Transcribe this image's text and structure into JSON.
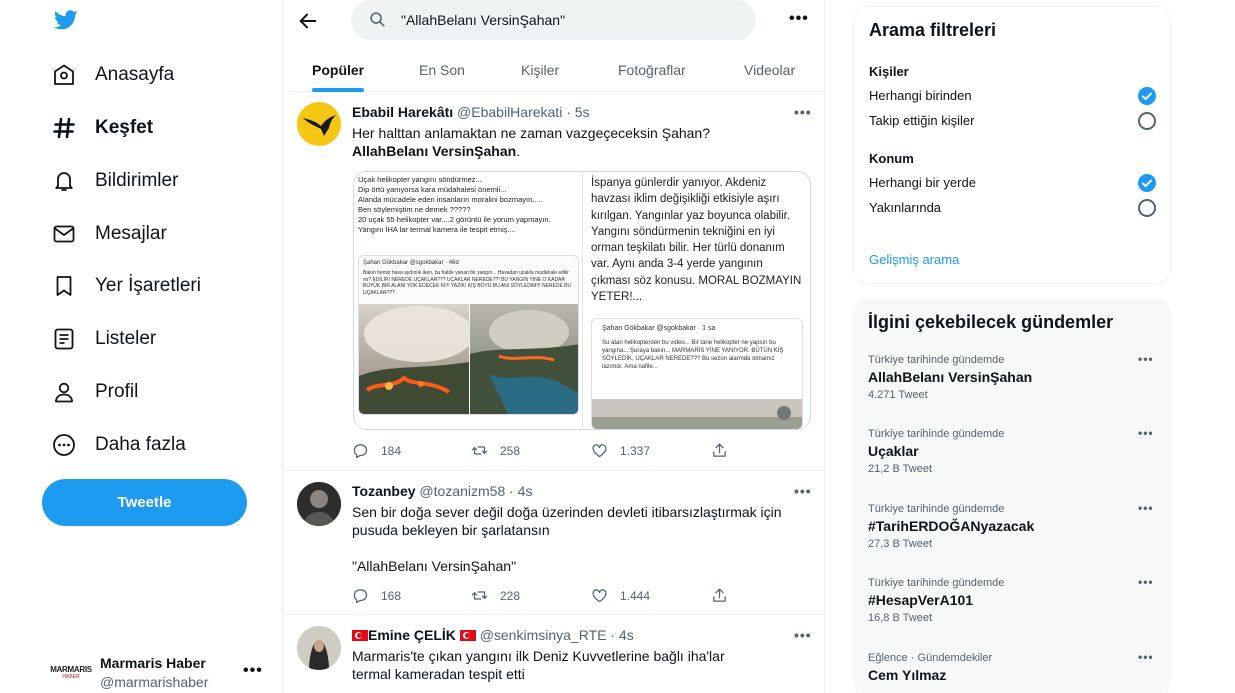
{
  "nav": {
    "items": [
      {
        "label": "Anasayfa",
        "icon": "home-icon"
      },
      {
        "label": "Keşfet",
        "icon": "hashtag-icon"
      },
      {
        "label": "Bildirimler",
        "icon": "bell-icon"
      },
      {
        "label": "Mesajlar",
        "icon": "envelope-icon"
      },
      {
        "label": "Yer İşaretleri",
        "icon": "bookmark-icon"
      },
      {
        "label": "Listeler",
        "icon": "list-icon"
      },
      {
        "label": "Profil",
        "icon": "person-icon"
      },
      {
        "label": "Daha fazla",
        "icon": "more-circle-icon"
      }
    ],
    "tweet_button": "Tweetle"
  },
  "account": {
    "logo_line1": "MARMARIS",
    "logo_line2": "HABER",
    "name": "Marmaris Haber",
    "handle": "@marmarishaber"
  },
  "search": {
    "query": "\"AllahBelanı VersinŞahan\"",
    "more": "•••"
  },
  "tabs": [
    "Popüler",
    "En Son",
    "Kişiler",
    "Fotoğraflar",
    "Videolar"
  ],
  "tweets": [
    {
      "name": "Ebabil Harekâtı",
      "handle": "@EbabilHarekati",
      "time": "· 5s",
      "text_plain": "Her halttan anlamaktan ne zaman vazgeçeceksin Şahan? ",
      "text_bold_1": "AllahBelanı",
      "text_bold_2": "VersinŞahan",
      "text_end": ".",
      "replies": "184",
      "retweets": "258",
      "likes": "1.337",
      "media": {
        "left_text": "Uçak helikopter yangını söndürmez...\nDip örtü yanıyorsa kara müdahalesi önemli...\nAlanda mücadele eden insanların moralini bozmayın.....\nBen söylemiştim ne demek ?????\n20 uçak 55 helikopter var....2 görüntü ile yorum yapmayın.\nYangını İHA lar termal kamera ile tespit etmiş....",
        "left_quote_head": "Şahan Gökbakar @sgokbakar · 46d",
        "left_quote_text": "Bakın hemiz hava aydınlık iken, bu halde yanan bir yangın... Havadan ucakla mudahale edilir mi? EDİLİR! NEREDE UÇAKLAR??? UÇAKLAR NEREDE??! BU YANGIN YINE O KADAR BÜYÜK BIR ALANI YOK EDECEK Kİ!!! YAZIK! KIŞ BOYU BU ANI SÖYLEDIM!!! NEREDE BU UÇAKLAR???",
        "right_text": "İspanya günlerdir yanıyor. Akdeniz havzası iklim değişikliği etkisiyle aşırı kırılgan. Yangınlar yaz boyunca olabilir. Yangını söndürmenin tekniğini en iyi orman teşkilatı bilir. Her türlü donanım var. Aynı anda 3-4 yerde yangının çıkması söz konusu. MORAL BOZMAYIN YETER!...",
        "right_quote_head": "Şahan Gökbakar @sgokbakar · 1 sa",
        "right_quote_text": "Su atan helikopterden bu video... Bir tane helikopter ne yapsın bu yangına... Şuraya bakın... MARMARİS YİNE YANIYOR. BÜTÜN KIŞ SÖYLEDİK. UÇAKLAR NEREDE??? Bu sezon alarmda olmamız lazımdı. Ama nafile..."
      }
    },
    {
      "name": "Tozanbey",
      "handle": "@tozanizm58",
      "time": "· 4s",
      "text_1": "Sen bir doğa sever değil doğa üzerinden devleti itibarsızlaştırmak için pusuda bekleyen bir şarlatansın",
      "text_2": "\"AllahBelanı VersinŞahan\"",
      "replies": "168",
      "retweets": "228",
      "likes": "1.444"
    },
    {
      "name": "Emine ÇELİK",
      "handle": "@senkimsinya_RTE",
      "time": "· 4s",
      "text": "Marmaris'te çıkan yangını ilk Deniz Kuvvetlerine bağlı iha'lar termal kameradan tespit etti"
    }
  ],
  "filters": {
    "title": "Arama filtreleri",
    "people_title": "Kişiler",
    "people_options": [
      {
        "label": "Herhangi birinden",
        "selected": true
      },
      {
        "label": "Takip ettiğin kişiler",
        "selected": false
      }
    ],
    "location_title": "Konum",
    "location_options": [
      {
        "label": "Herhangi bir yerde",
        "selected": true
      },
      {
        "label": "Yakınlarında",
        "selected": false
      }
    ],
    "advanced": "Gelişmiş arama"
  },
  "trends": {
    "title": "İlgini çekebilecek gündemler",
    "items": [
      {
        "category": "Türkiye tarihinde gündemde",
        "name": "AllahBelanı VersinŞahan",
        "count": "4.271 Tweet"
      },
      {
        "category": "Türkiye tarihinde gündemde",
        "name": "Uçaklar",
        "count": "21,2 B Tweet"
      },
      {
        "category": "Türkiye tarihinde gündemde",
        "name": "#TarihERDOĞANyazacak",
        "count": "27,3 B Tweet"
      },
      {
        "category": "Türkiye tarihinde gündemde",
        "name": "#HesapVerA101",
        "count": "16,8 B Tweet"
      },
      {
        "category": "Eğlence · Gündemdekiler",
        "name": "Cem Yılmaz",
        "count": ""
      }
    ]
  },
  "colors": {
    "accent": "#1d9bf0",
    "text": "#0f1419",
    "muted": "#536471",
    "border": "#eff3f4"
  }
}
